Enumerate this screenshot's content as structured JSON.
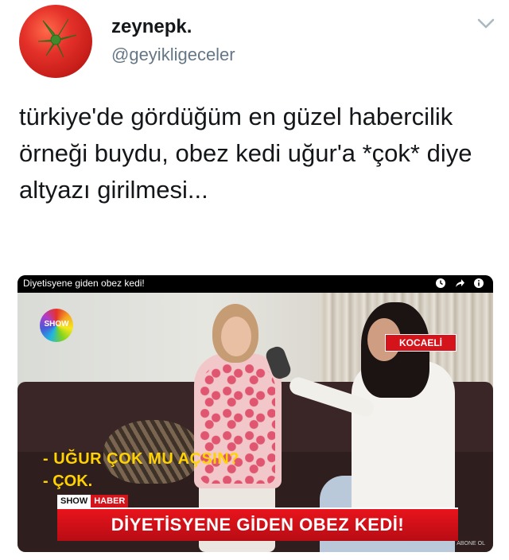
{
  "tweet": {
    "display_name": "zeynepk.",
    "handle": "@geyikligeceler",
    "text": "türkiye'de gördüğüm en güzel habercilik örneği buydu, obez kedi uğur'a *çok* diye altyazı girilmesi..."
  },
  "video": {
    "title": "Diyetisyene giden obez kedi!",
    "icons": [
      "clock-icon",
      "share-icon",
      "info-icon"
    ],
    "channel_logo": "SHOW",
    "location_tag": "KOCAELİ",
    "subtitle_line_1": "- UĞUR ÇOK MU AÇSIN?",
    "subtitle_line_2": "- ÇOK.",
    "program_show": "SHOW",
    "program_haber": "HABER",
    "headline": "DİYETİSYENE GİDEN OBEZ KEDİ!",
    "corner_mark": "ABONE OL"
  },
  "colors": {
    "brand_red": "#d4131b",
    "subtitle_yellow": "#ffd200",
    "handle_gray": "#657786"
  }
}
